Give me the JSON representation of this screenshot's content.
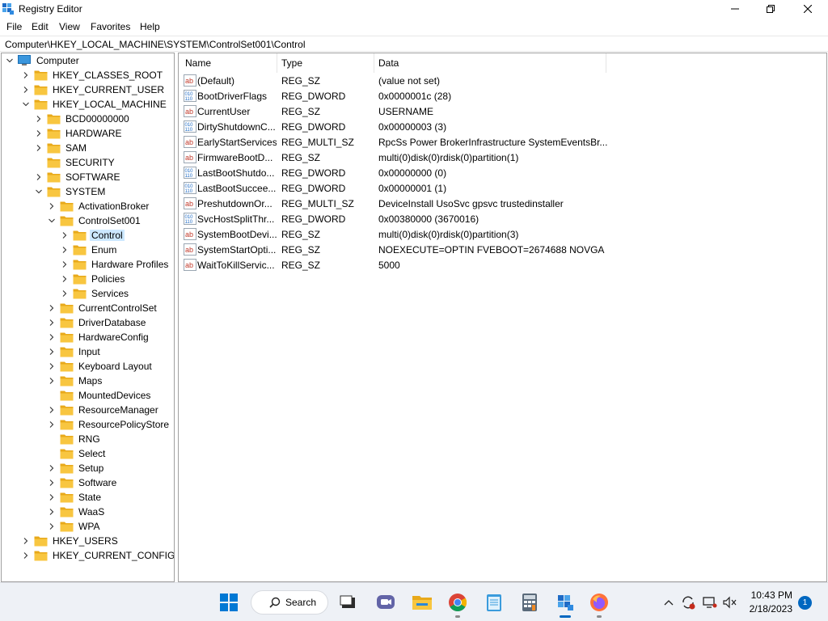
{
  "window": {
    "title": "Registry Editor"
  },
  "menu": [
    "File",
    "Edit",
    "View",
    "Favorites",
    "Help"
  ],
  "address": "Computer\\HKEY_LOCAL_MACHINE\\SYSTEM\\ControlSet001\\Control",
  "tree": {
    "root": "Computer",
    "items": [
      {
        "label": "HKEY_CLASSES_ROOT",
        "level": 1,
        "state": "collapsed"
      },
      {
        "label": "HKEY_CURRENT_USER",
        "level": 1,
        "state": "collapsed"
      },
      {
        "label": "HKEY_LOCAL_MACHINE",
        "level": 1,
        "state": "expanded"
      },
      {
        "label": "BCD00000000",
        "level": 2,
        "state": "collapsed"
      },
      {
        "label": "HARDWARE",
        "level": 2,
        "state": "collapsed"
      },
      {
        "label": "SAM",
        "level": 2,
        "state": "collapsed"
      },
      {
        "label": "SECURITY",
        "level": 2,
        "state": "none"
      },
      {
        "label": "SOFTWARE",
        "level": 2,
        "state": "collapsed"
      },
      {
        "label": "SYSTEM",
        "level": 2,
        "state": "expanded"
      },
      {
        "label": "ActivationBroker",
        "level": 3,
        "state": "collapsed"
      },
      {
        "label": "ControlSet001",
        "level": 3,
        "state": "expanded"
      },
      {
        "label": "Control",
        "level": 4,
        "state": "collapsed",
        "selected": true
      },
      {
        "label": "Enum",
        "level": 4,
        "state": "collapsed"
      },
      {
        "label": "Hardware Profiles",
        "level": 4,
        "state": "collapsed"
      },
      {
        "label": "Policies",
        "level": 4,
        "state": "collapsed"
      },
      {
        "label": "Services",
        "level": 4,
        "state": "collapsed"
      },
      {
        "label": "CurrentControlSet",
        "level": 3,
        "state": "collapsed"
      },
      {
        "label": "DriverDatabase",
        "level": 3,
        "state": "collapsed"
      },
      {
        "label": "HardwareConfig",
        "level": 3,
        "state": "collapsed"
      },
      {
        "label": "Input",
        "level": 3,
        "state": "collapsed"
      },
      {
        "label": "Keyboard Layout",
        "level": 3,
        "state": "collapsed"
      },
      {
        "label": "Maps",
        "level": 3,
        "state": "collapsed"
      },
      {
        "label": "MountedDevices",
        "level": 3,
        "state": "none"
      },
      {
        "label": "ResourceManager",
        "level": 3,
        "state": "collapsed"
      },
      {
        "label": "ResourcePolicyStore",
        "level": 3,
        "state": "collapsed"
      },
      {
        "label": "RNG",
        "level": 3,
        "state": "none"
      },
      {
        "label": "Select",
        "level": 3,
        "state": "none"
      },
      {
        "label": "Setup",
        "level": 3,
        "state": "collapsed"
      },
      {
        "label": "Software",
        "level": 3,
        "state": "collapsed"
      },
      {
        "label": "State",
        "level": 3,
        "state": "collapsed"
      },
      {
        "label": "WaaS",
        "level": 3,
        "state": "collapsed"
      },
      {
        "label": "WPA",
        "level": 3,
        "state": "collapsed"
      },
      {
        "label": "HKEY_USERS",
        "level": 1,
        "state": "collapsed"
      },
      {
        "label": "HKEY_CURRENT_CONFIG",
        "level": 1,
        "state": "collapsed"
      }
    ]
  },
  "list": {
    "columns": [
      "Name",
      "Type",
      "Data"
    ],
    "rows": [
      {
        "name": "(Default)",
        "type": "REG_SZ",
        "data": "(value not set)",
        "icon": "string-value-icon"
      },
      {
        "name": "BootDriverFlags",
        "type": "REG_DWORD",
        "data": "0x0000001c (28)",
        "icon": "binary-value-icon"
      },
      {
        "name": "CurrentUser",
        "type": "REG_SZ",
        "data": "USERNAME",
        "icon": "string-value-icon"
      },
      {
        "name": "DirtyShutdownC...",
        "type": "REG_DWORD",
        "data": "0x00000003 (3)",
        "icon": "binary-value-icon"
      },
      {
        "name": "EarlyStartServices",
        "type": "REG_MULTI_SZ",
        "data": "RpcSs Power BrokerInfrastructure SystemEventsBr...",
        "icon": "string-value-icon"
      },
      {
        "name": "FirmwareBootD...",
        "type": "REG_SZ",
        "data": "multi(0)disk(0)rdisk(0)partition(1)",
        "icon": "string-value-icon"
      },
      {
        "name": "LastBootShutdo...",
        "type": "REG_DWORD",
        "data": "0x00000000 (0)",
        "icon": "binary-value-icon"
      },
      {
        "name": "LastBootSuccee...",
        "type": "REG_DWORD",
        "data": "0x00000001 (1)",
        "icon": "binary-value-icon"
      },
      {
        "name": "PreshutdownOr...",
        "type": "REG_MULTI_SZ",
        "data": "DeviceInstall UsoSvc gpsvc trustedinstaller",
        "icon": "string-value-icon"
      },
      {
        "name": "SvcHostSplitThr...",
        "type": "REG_DWORD",
        "data": "0x00380000 (3670016)",
        "icon": "binary-value-icon"
      },
      {
        "name": "SystemBootDevi...",
        "type": "REG_SZ",
        "data": "multi(0)disk(0)rdisk(0)partition(3)",
        "icon": "string-value-icon"
      },
      {
        "name": "SystemStartOpti...",
        "type": "REG_SZ",
        "data": " NOEXECUTE=OPTIN  FVEBOOT=2674688  NOVGA",
        "icon": "string-value-icon"
      },
      {
        "name": "WaitToKillServic...",
        "type": "REG_SZ",
        "data": "5000",
        "icon": "string-value-icon"
      }
    ]
  },
  "taskbar": {
    "search_label": "Search",
    "time": "10:43 PM",
    "date": "2/18/2023",
    "notification_count": "1",
    "apps": [
      "start-icon",
      "task-view-icon",
      "chat-icon",
      "file-explorer-icon",
      "chrome-icon",
      "notepad-icon",
      "calculator-icon",
      "regedit-icon",
      "firefox-icon"
    ]
  },
  "colors": {
    "selection": "#cce8ff",
    "folder": "#f8c640",
    "accent": "#0067c0"
  }
}
